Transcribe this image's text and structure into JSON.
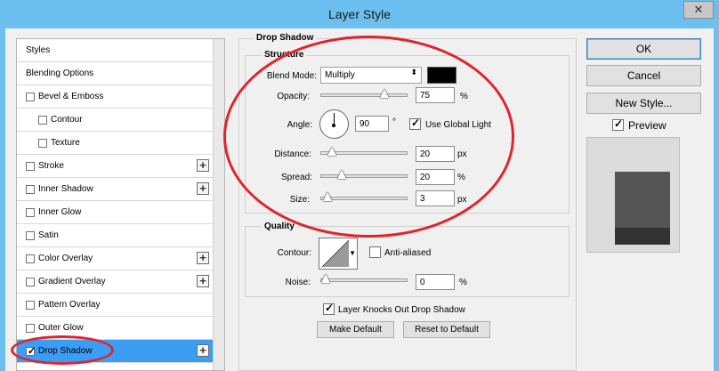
{
  "window": {
    "title": "Layer Style",
    "close_glyph": "✕"
  },
  "sidebar": {
    "items": [
      {
        "label": "Styles",
        "checkbox": false,
        "indent": false,
        "plus": false,
        "checked": false,
        "active": false
      },
      {
        "label": "Blending Options",
        "checkbox": false,
        "indent": false,
        "plus": false,
        "checked": false,
        "active": false
      },
      {
        "label": "Bevel & Emboss",
        "checkbox": true,
        "indent": false,
        "plus": false,
        "checked": false,
        "active": false
      },
      {
        "label": "Contour",
        "checkbox": true,
        "indent": true,
        "plus": false,
        "checked": false,
        "active": false
      },
      {
        "label": "Texture",
        "checkbox": true,
        "indent": true,
        "plus": false,
        "checked": false,
        "active": false
      },
      {
        "label": "Stroke",
        "checkbox": true,
        "indent": false,
        "plus": true,
        "checked": false,
        "active": false
      },
      {
        "label": "Inner Shadow",
        "checkbox": true,
        "indent": false,
        "plus": true,
        "checked": false,
        "active": false
      },
      {
        "label": "Inner Glow",
        "checkbox": true,
        "indent": false,
        "plus": false,
        "checked": false,
        "active": false
      },
      {
        "label": "Satin",
        "checkbox": true,
        "indent": false,
        "plus": false,
        "checked": false,
        "active": false
      },
      {
        "label": "Color Overlay",
        "checkbox": true,
        "indent": false,
        "plus": true,
        "checked": false,
        "active": false
      },
      {
        "label": "Gradient Overlay",
        "checkbox": true,
        "indent": false,
        "plus": true,
        "checked": false,
        "active": false
      },
      {
        "label": "Pattern Overlay",
        "checkbox": true,
        "indent": false,
        "plus": false,
        "checked": false,
        "active": false
      },
      {
        "label": "Outer Glow",
        "checkbox": true,
        "indent": false,
        "plus": false,
        "checked": false,
        "active": false
      },
      {
        "label": "Drop Shadow",
        "checkbox": true,
        "indent": false,
        "plus": true,
        "checked": true,
        "active": true
      }
    ],
    "plus_glyph": "+",
    "check_glyph": "✓"
  },
  "drop_shadow": {
    "heading": "Drop Shadow",
    "structure": {
      "legend": "Structure",
      "blend_mode_label": "Blend Mode:",
      "blend_mode_value": "Multiply",
      "blend_arrow": "⬍",
      "shadow_color": "#000000",
      "opacity_label": "Opacity:",
      "opacity_value": "75",
      "opacity_fraction": 0.75,
      "percent": "%",
      "angle_label": "Angle:",
      "angle_value": "90",
      "degree": "°",
      "use_global_light_label": "Use Global Light",
      "use_global_light_checked": true,
      "distance_label": "Distance:",
      "distance_value": "20",
      "distance_fraction": 0.08,
      "px": "px",
      "spread_label": "Spread:",
      "spread_value": "20",
      "spread_fraction": 0.2,
      "size_label": "Size:",
      "size_value": "3",
      "size_fraction": 0.02
    },
    "quality": {
      "legend": "Quality",
      "contour_label": "Contour:",
      "anti_aliased_label": "Anti-aliased",
      "noise_label": "Noise:",
      "noise_value": "0",
      "noise_fraction": 0.0
    },
    "knocks_out_label": "Layer Knocks Out Drop Shadow",
    "knocks_out_checked": true,
    "make_default": "Make Default",
    "reset_default": "Reset to Default"
  },
  "right": {
    "ok": "OK",
    "cancel": "Cancel",
    "new_style": "New Style...",
    "preview_label": "Preview",
    "preview_checked": true
  },
  "colors": {
    "titlebar": "#6cc0ef",
    "active_row": "#3c9df5",
    "annotation": "#e0242d"
  }
}
